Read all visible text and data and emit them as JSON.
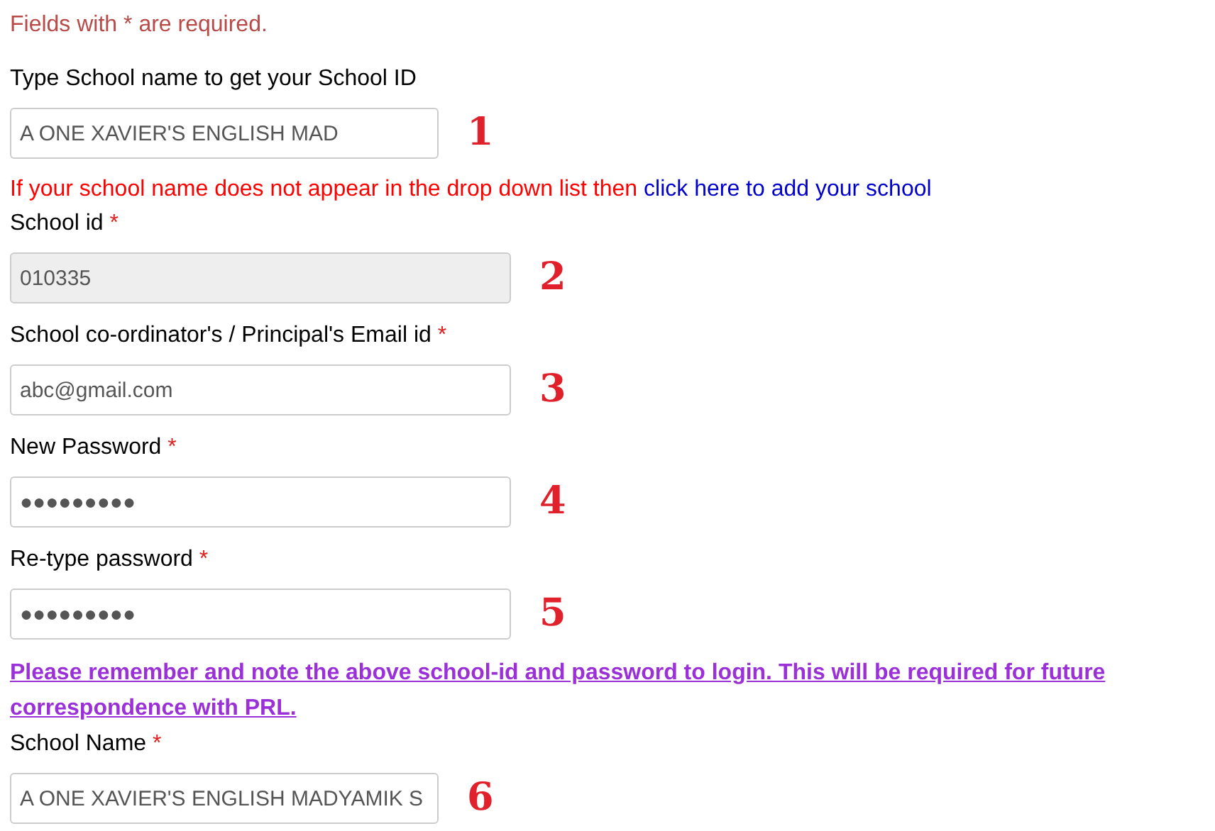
{
  "required_note": "Fields with * are required.",
  "form": [
    {
      "kind": "short-field",
      "label": "Type School name to get your School ID",
      "value": "A ONE XAVIER'S ENGLISH MAD",
      "disabled": false,
      "step": "1"
    },
    {
      "kind": "hint",
      "text": "If your school name does not appear in the drop down list then",
      "link": "click here to add your school"
    },
    {
      "kind": "field",
      "label": "School id",
      "required_mark": "*",
      "value": "010335",
      "disabled": true,
      "step": "2"
    },
    {
      "kind": "field",
      "label": "School co-ordinator's / Principal's Email id",
      "required_mark": "*",
      "value": "abc@gmail.com",
      "disabled": false,
      "step": "3"
    },
    {
      "kind": "field",
      "label": "New Password",
      "required_mark": "*",
      "value": "●●●●●●●●●",
      "disabled": false,
      "step": "4"
    },
    {
      "kind": "field",
      "label": "Re-type password",
      "required_mark": "*",
      "value": "●●●●●●●●●",
      "disabled": false,
      "step": "5"
    },
    {
      "kind": "warning",
      "text": "Please remember and note the above school-id and password to login. This will be required for future correspondence with PRL."
    },
    {
      "kind": "short-field",
      "label": "School Name",
      "required_mark": "*",
      "value": "A ONE XAVIER'S ENGLISH MADYAMIK S",
      "disabled": false,
      "step": "6"
    }
  ]
}
